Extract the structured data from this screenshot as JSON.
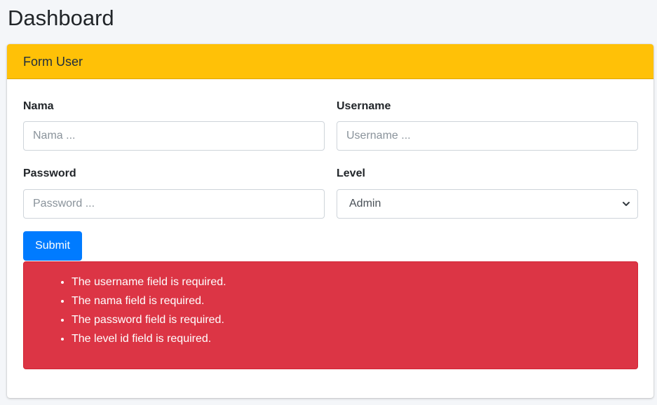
{
  "header": {
    "title": "Dashboard"
  },
  "card": {
    "title": "Form User",
    "fields": {
      "nama": {
        "label": "Nama",
        "placeholder": "Nama ...",
        "value": ""
      },
      "username": {
        "label": "Username",
        "placeholder": "Username ...",
        "value": ""
      },
      "password": {
        "label": "Password",
        "placeholder": "Password ...",
        "value": ""
      },
      "level": {
        "label": "Level",
        "selected": "Admin"
      }
    },
    "submit_label": "Submit",
    "errors": [
      "The username field is required.",
      "The nama field is required.",
      "The password field is required.",
      "The level id field is required."
    ]
  },
  "colors": {
    "header_accent": "#ffc107",
    "primary": "#007bff",
    "danger": "#dc3545"
  },
  "icons": {
    "select_caret": "chevron-down-icon"
  }
}
